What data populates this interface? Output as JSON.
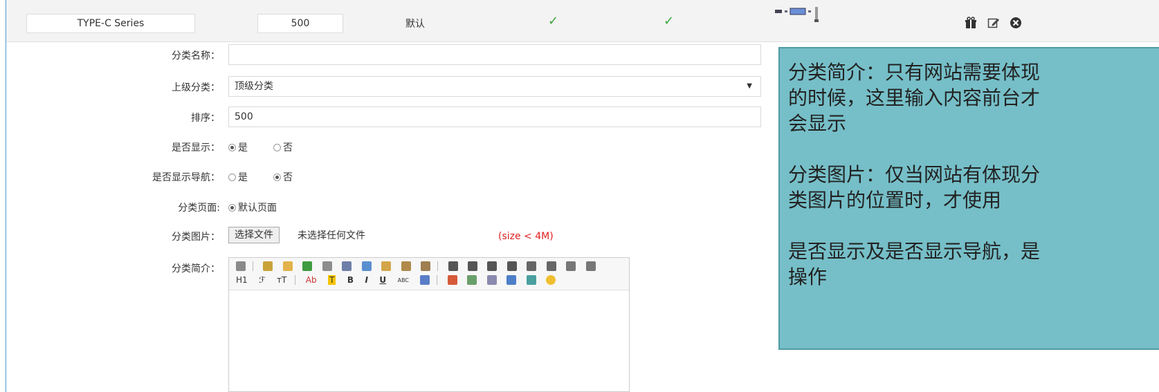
{
  "list_row": {
    "name": "TYPE-C Series",
    "sort": "500",
    "page": "默认",
    "show_check": "✓",
    "nav_check": "✓",
    "thumbnail_icon": "product-thumbnail",
    "actions": [
      "gift-icon",
      "edit-icon",
      "close-circle-icon"
    ]
  },
  "form": {
    "name_label": "分类名称：",
    "name_value": "",
    "parent_label": "上级分类：",
    "parent_value": "顶级分类",
    "sort_label": "排序：",
    "sort_value": "500",
    "show_label": "是否显示：",
    "show_yes": "是",
    "show_no": "否",
    "show_selected": "是",
    "nav_label": "是否显示导航：",
    "nav_yes": "是",
    "nav_no": "否",
    "nav_selected": "否",
    "page_label": "分类页面:",
    "page_option": "默认页面",
    "image_label": "分类图片：",
    "file_button": "选择文件",
    "file_status": "未选择任何文件",
    "size_note": "(size < 4M)",
    "intro_label": "分类简介：",
    "toolbar_row2": [
      "H1",
      "ℱ",
      "тT",
      "Ab",
      "T",
      "B",
      "I",
      "U",
      "ABC"
    ]
  },
  "callout": {
    "lines": [
      "分类简介：只有网站需要体现",
      "的时候，这里输入内容前台才",
      "会显示",
      "",
      "分类图片：仅当网站有体现分",
      "类图片的位置时，才使用",
      "",
      "是否显示及是否显示导航，是",
      "操作"
    ]
  },
  "colors": {
    "accent_border": "#4a9ad6",
    "callout_bg": "#76bfc8",
    "check": "#3aa53a",
    "size_note": "#e02020"
  }
}
